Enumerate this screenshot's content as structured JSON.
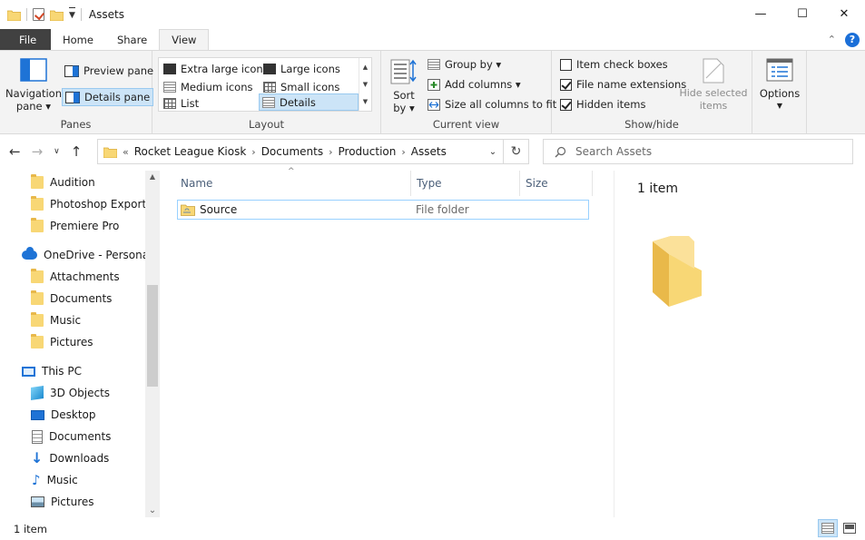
{
  "window": {
    "title": "Assets",
    "controls": {
      "minimize": "—",
      "maximize": "☐",
      "close": "✕"
    }
  },
  "ribbon_tabs": [
    "File",
    "Home",
    "Share",
    "View"
  ],
  "ribbon": {
    "panes": {
      "label": "Panes",
      "navigation_pane": "Navigation\npane ▾",
      "preview_pane": "Preview pane",
      "details_pane": "Details pane"
    },
    "layout": {
      "label": "Layout",
      "items": [
        "Extra large icons",
        "Large icons",
        "Medium icons",
        "Small icons",
        "List",
        "Details"
      ],
      "selected": "Details"
    },
    "current_view": {
      "label": "Current view",
      "sort_by": "Sort\nby ▾",
      "group_by": "Group by ▾",
      "add_columns": "Add columns ▾",
      "size_all_columns": "Size all columns to fit"
    },
    "show_hide": {
      "label": "Show/hide",
      "item_check_boxes": {
        "label": "Item check boxes",
        "checked": false
      },
      "file_name_extensions": {
        "label": "File name extensions",
        "checked": true
      },
      "hidden_items": {
        "label": "Hidden items",
        "checked": true
      },
      "hide_selected_items": "Hide selected\nitems"
    },
    "options": "Options"
  },
  "address": {
    "overflow": "«",
    "crumbs": [
      "Rocket League Kiosk",
      "Documents",
      "Production",
      "Assets"
    ]
  },
  "search": {
    "placeholder": "Search Assets"
  },
  "sidebar": {
    "items": [
      {
        "label": "Audition",
        "icon": "folder-icon"
      },
      {
        "label": "Photoshop Exports",
        "icon": "folder-icon"
      },
      {
        "label": "Premiere Pro",
        "icon": "folder-icon"
      },
      {
        "label": "OneDrive - Personal",
        "icon": "onedrive-icon"
      },
      {
        "label": "Attachments",
        "icon": "folder-icon"
      },
      {
        "label": "Documents",
        "icon": "folder-icon"
      },
      {
        "label": "Music",
        "icon": "folder-icon"
      },
      {
        "label": "Pictures",
        "icon": "folder-icon"
      },
      {
        "label": "This PC",
        "icon": "computer-icon"
      },
      {
        "label": "3D Objects",
        "icon": "3d-objects-icon"
      },
      {
        "label": "Desktop",
        "icon": "desktop-icon"
      },
      {
        "label": "Documents",
        "icon": "documents-icon"
      },
      {
        "label": "Downloads",
        "icon": "download-icon"
      },
      {
        "label": "Music",
        "icon": "music-icon"
      },
      {
        "label": "Pictures",
        "icon": "pictures-icon"
      }
    ]
  },
  "file_list": {
    "columns": [
      "Name",
      "Type",
      "Size"
    ],
    "rows": [
      {
        "name": "Source",
        "type": "File folder",
        "size": ""
      }
    ]
  },
  "preview": {
    "count": "1 item"
  },
  "status": {
    "count": "1 item"
  },
  "colors": {
    "file_tab": "#414141",
    "selection": "#cce4f7",
    "selection_border": "#99c9ef",
    "folder": "#f8d775",
    "accent_blue": "#1e73d6"
  }
}
